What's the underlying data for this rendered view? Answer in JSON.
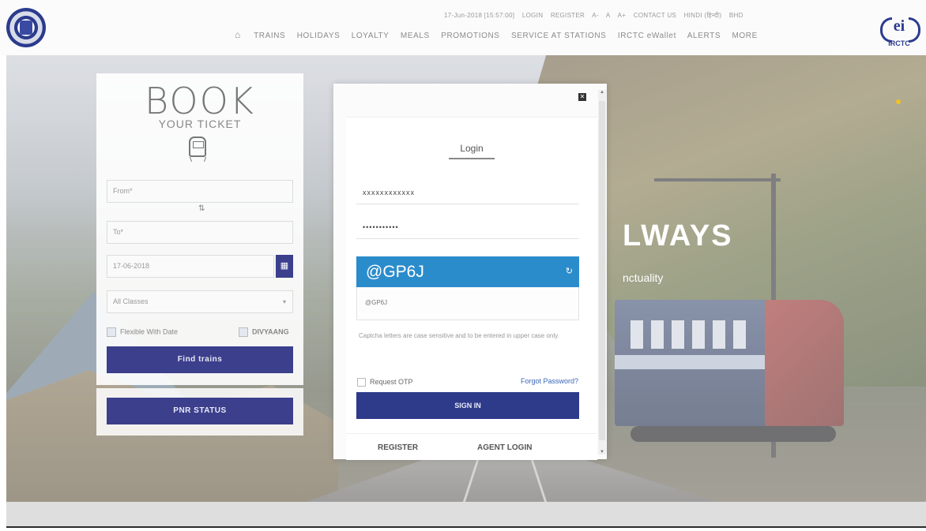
{
  "header": {
    "top_links": [
      "17-Jun-2018 [15:57:00]",
      "LOGIN",
      "REGISTER",
      "A-",
      "A",
      "A+",
      "CONTACT US",
      "HINDI (हिन्दी)",
      "BHD"
    ],
    "nav_home_icon": "home-icon",
    "nav_items": [
      "TRAINS",
      "HOLIDAYS",
      "LOYALTY",
      "MEALS",
      "PROMOTIONS",
      "SERVICE AT STATIONS",
      "IRCTC eWallet",
      "ALERTS",
      "MORE"
    ],
    "logo_right_text": "IRCTC"
  },
  "hero": {
    "headline": "LWAYS",
    "sub": "nctuality",
    "colors": {
      "accent": "#3b3f8c",
      "captcha": "#2b8ccc",
      "signin": "#2e3a8a"
    }
  },
  "booking": {
    "title": "BOOK",
    "subtitle": "YOUR TICKET",
    "from_placeholder": "From*",
    "swap_icon": "⇅",
    "to_placeholder": "To*",
    "date_value": "17-06-2018",
    "class_value": "All Classes",
    "flexible_label": "Flexible With Date",
    "divyang_label": "DIVYAANG",
    "find_button": "Find trains",
    "pnr_button": "PNR STATUS"
  },
  "login": {
    "close_icon": "✕",
    "title": "Login",
    "username_value": "xxxxxxxxxxxx",
    "password_value": "•••••••••••",
    "captcha_typed": "@GP6J",
    "captcha_refresh_icon": "↻",
    "captcha_image_text": "@GP6J",
    "captcha_note": "Captcha letters are case sensitive and to be entered in upper case only.",
    "request_otp_label": "Request OTP",
    "forgot_password": "Forgot Password?",
    "signin_button": "SIGN IN",
    "register_link": "REGISTER",
    "agent_login_link": "AGENT LOGIN"
  }
}
